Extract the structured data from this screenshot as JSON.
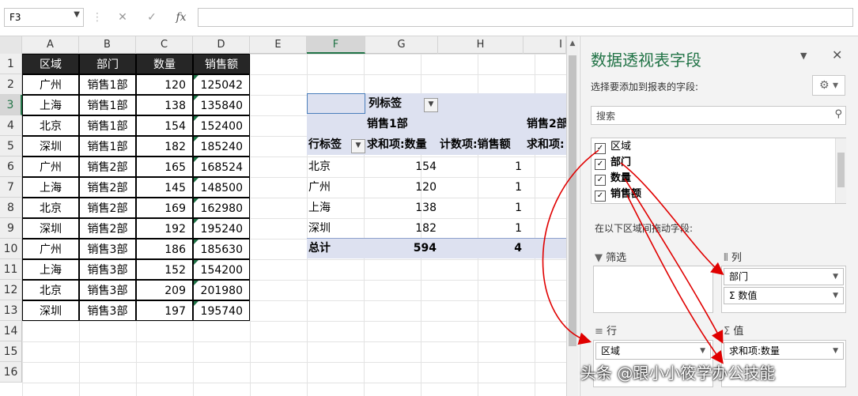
{
  "formula_bar": {
    "name_box": "F3",
    "cancel_icon": "✕",
    "enter_icon": "✓",
    "fx_icon": "fx",
    "formula": ""
  },
  "columns": [
    "A",
    "B",
    "C",
    "D",
    "E",
    "F",
    "G",
    "H",
    "I"
  ],
  "rows": [
    "1",
    "2",
    "3",
    "4",
    "5",
    "6",
    "7",
    "8",
    "9",
    "10",
    "11",
    "12",
    "13",
    "14",
    "15",
    "16"
  ],
  "data_table": {
    "headers": [
      "区域",
      "部门",
      "数量",
      "销售额"
    ],
    "rows": [
      [
        "广州",
        "销售1部",
        "120",
        "125042"
      ],
      [
        "上海",
        "销售1部",
        "138",
        "135840"
      ],
      [
        "北京",
        "销售1部",
        "154",
        "152400"
      ],
      [
        "深圳",
        "销售1部",
        "182",
        "185240"
      ],
      [
        "广州",
        "销售2部",
        "165",
        "168524"
      ],
      [
        "上海",
        "销售2部",
        "145",
        "148500"
      ],
      [
        "北京",
        "销售2部",
        "169",
        "162980"
      ],
      [
        "深圳",
        "销售2部",
        "192",
        "195240"
      ],
      [
        "广州",
        "销售3部",
        "186",
        "185630"
      ],
      [
        "上海",
        "销售3部",
        "152",
        "154200"
      ],
      [
        "北京",
        "销售3部",
        "209",
        "201980"
      ],
      [
        "深圳",
        "销售3部",
        "197",
        "195740"
      ]
    ]
  },
  "pivot": {
    "col_labels": "列标签",
    "dept1": "销售1部",
    "dept2": "销售2部",
    "row_labels": "行标签",
    "sum_qty": "求和项:数量",
    "count_sales": "计数项:销售额",
    "sum_qty2": "求和项:",
    "rows": [
      [
        "北京",
        "154",
        "1"
      ],
      [
        "广州",
        "120",
        "1"
      ],
      [
        "上海",
        "138",
        "1"
      ],
      [
        "深圳",
        "182",
        "1"
      ]
    ],
    "total": [
      "总计",
      "594",
      "4"
    ]
  },
  "panel": {
    "title": "数据透视表字段",
    "subtitle": "选择要添加到报表的字段:",
    "search_placeholder": "搜索",
    "fields": [
      "区域",
      "部门",
      "数量",
      "销售额"
    ],
    "drag_hint": "在以下区域间拖动字段:",
    "filter_label": "筛选",
    "columns_label": "列",
    "rows_label": "行",
    "values_label": "值",
    "column_items": [
      "部门",
      "数值"
    ],
    "row_items": [
      "区域"
    ],
    "value_items": [
      "求和项:数量"
    ]
  },
  "watermark": "头条 @跟小小筱学办公技能",
  "colors": {
    "accent": "#217346",
    "arrow": "#e00000",
    "pivot_header": "#dde1f0"
  }
}
